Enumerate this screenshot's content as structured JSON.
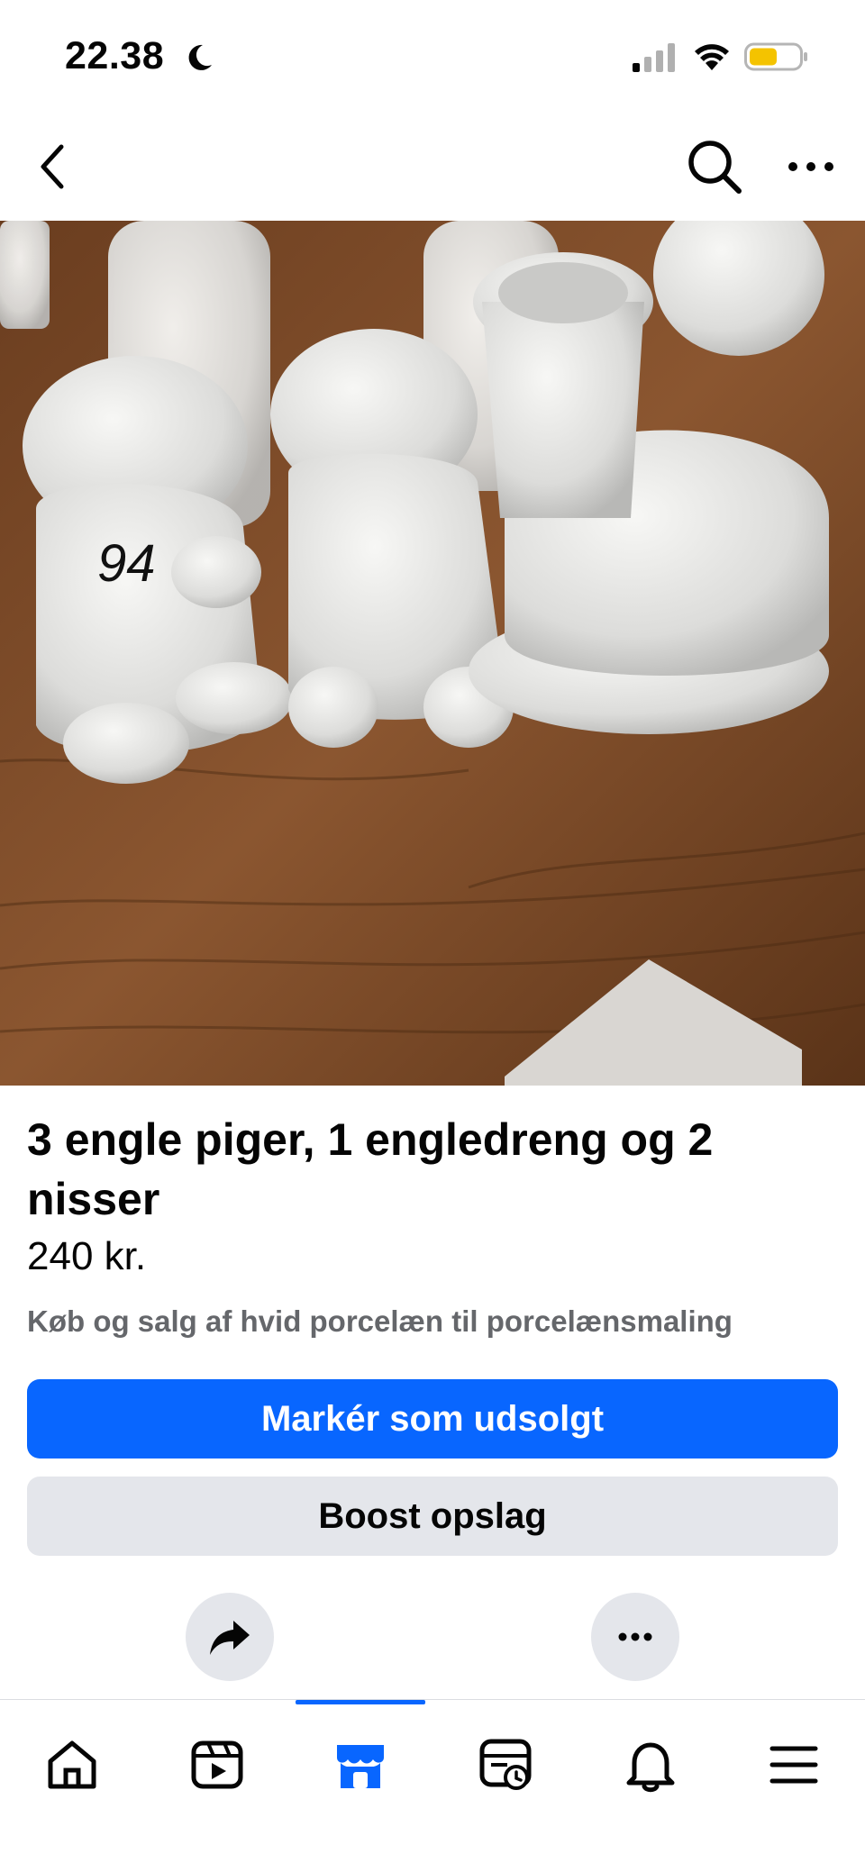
{
  "status_bar": {
    "time": "22.38",
    "icons": [
      "moon-icon",
      "signal-icon",
      "wifi-icon",
      "battery-icon"
    ]
  },
  "header": {
    "icons": [
      "back-icon",
      "search-icon",
      "more-icon"
    ]
  },
  "listing": {
    "photo_description": "photo",
    "title": "3 engle piger, 1 engledreng og 2 nisser",
    "price": "240 kr.",
    "group": "Køb og salg af hvid porcelæn til porcelænsmaling"
  },
  "actions": {
    "mark_sold_label": "Markér som udsolgt",
    "boost_label": "Boost opslag",
    "icons": [
      "share-icon",
      "more-icon"
    ]
  },
  "tabbar": {
    "active_tab": "marketplace",
    "tabs": [
      "home",
      "video",
      "marketplace",
      "feeds",
      "notifications",
      "menu"
    ]
  },
  "colors": {
    "accent": "#0866ff",
    "secondary_button": "#e4e6eb",
    "muted_text": "#65676b",
    "battery_fill": "#f4c300"
  }
}
